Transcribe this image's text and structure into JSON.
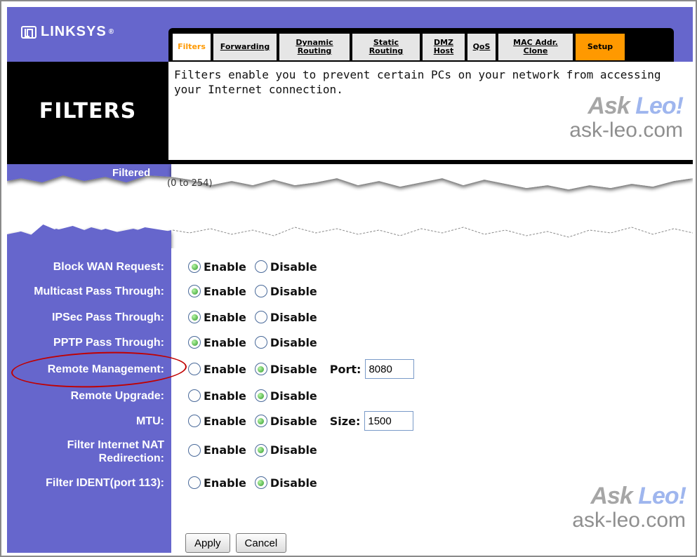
{
  "header": {
    "logo_text": "LINKSYS",
    "logo_mark": "®",
    "tabs": [
      {
        "label": "Filters",
        "active": true
      },
      {
        "label": "Forwarding"
      },
      {
        "label": "Dynamic Routing"
      },
      {
        "label": "Static Routing"
      },
      {
        "label": "DMZ Host"
      },
      {
        "label": "QoS"
      },
      {
        "label": "MAC Addr. Clone"
      },
      {
        "label": "Setup"
      }
    ]
  },
  "page": {
    "title": "FILTERS",
    "description": "Filters enable you to prevent certain PCs on your network from accessing your Internet connection."
  },
  "watermark": {
    "ask": "Ask",
    "leo": "Leo!",
    "url": "ask-leo.com"
  },
  "torn_section": {
    "label": "Filtered",
    "range": "(0 to 254)"
  },
  "options": {
    "enable": "Enable",
    "disable": "Disable"
  },
  "settings": [
    {
      "label": "Block WAN Request:",
      "selected": "Enable"
    },
    {
      "label": "Multicast Pass Through:",
      "selected": "Enable"
    },
    {
      "label": "IPSec Pass Through:",
      "selected": "Enable"
    },
    {
      "label": "PPTP Pass Through:",
      "selected": "Enable"
    },
    {
      "label": "Remote Management:",
      "selected": "Disable",
      "extra_label": "Port:",
      "extra_value": "8080"
    },
    {
      "label": "Remote Upgrade:",
      "selected": "Disable"
    },
    {
      "label": "MTU:",
      "selected": "Disable",
      "extra_label": "Size:",
      "extra_value": "1500"
    },
    {
      "label": "Filter Internet NAT Redirection:",
      "selected": "Disable"
    },
    {
      "label": "Filter IDENT(port 113):",
      "selected": "Disable"
    }
  ],
  "buttons": {
    "apply": "Apply",
    "cancel": "Cancel"
  },
  "colors": {
    "brand_purple": "#6666cc",
    "accent_orange": "#ff9900",
    "highlight_red": "#c00000"
  }
}
